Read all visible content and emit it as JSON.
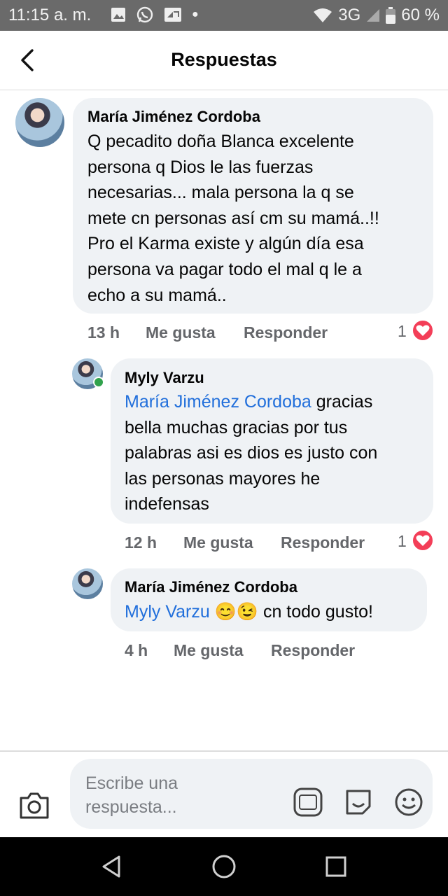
{
  "status_bar": {
    "time": "11:15 a. m.",
    "network": "3G",
    "battery": "60 %"
  },
  "header": {
    "title": "Respuestas"
  },
  "comments": [
    {
      "author": "María Jiménez Cordoba",
      "lines": [
        "Q pecadito doña  Blanca excelente",
        "persona q Dios le las  fuerzas",
        "necesarias... mala persona la q se",
        "mete cn personas así cm su mamá..!!",
        "Pro el Karma existe y algún día esa",
        "persona  va pagar todo el mal q le a",
        "echo a su mamá.."
      ],
      "time": "13 h",
      "like": "Me gusta",
      "reply": "Responder",
      "reactions": "1"
    },
    {
      "author": "Myly Varzu",
      "mention": "María Jiménez Cordoba",
      "first_line_rest": " gracias",
      "lines": [
        "bella muchas gracias por tus",
        "palabras asi es dios es justo con",
        "las personas mayores he",
        "indefensas"
      ],
      "time": "12 h",
      "like": "Me gusta",
      "reply": "Responder",
      "reactions": "1"
    },
    {
      "author": "María Jiménez Cordoba",
      "mention": "Myly Varzu",
      "emoji": "😊😉",
      "rest": " cn todo gusto!",
      "time": "4 h",
      "like": "Me gusta",
      "reply": "Responder"
    }
  ],
  "composer": {
    "placeholder_line1": "Escribe una",
    "placeholder_line2": "respuesta..."
  }
}
